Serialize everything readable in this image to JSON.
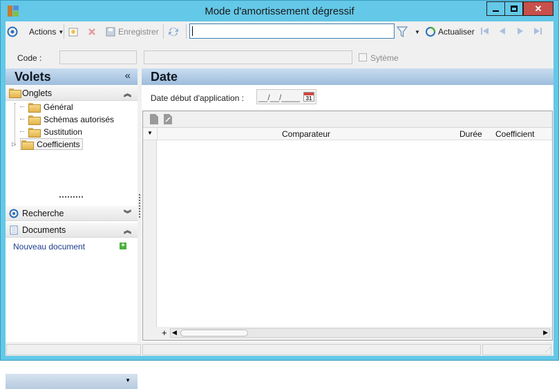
{
  "window": {
    "title": "Mode d'amortissement dégressif",
    "minimize": "—",
    "maximize": "□",
    "close": "✕"
  },
  "toolbar": {
    "actions_label": "Actions",
    "save_label": "Enregistrer",
    "search_value": "",
    "refresh_label": "Actualiser"
  },
  "record": {
    "code_label": "Code :",
    "code_value": "",
    "description_value": "",
    "system_label": "Sytème"
  },
  "left_panel": {
    "title": "Volets",
    "collapse_glyph": "«",
    "tabs_section": "Onglets",
    "tree": [
      "Général",
      "Schémas autorisés",
      "Sustitution",
      "Coefficients"
    ],
    "selected": "Coefficients",
    "search_section": "Recherche",
    "documents_section": "Documents",
    "new_document": "Nouveau document"
  },
  "main": {
    "title": "Date",
    "start_date_label": "Date début d'application :",
    "start_date_value": "__/__/____",
    "calendar_day": "31",
    "grid": {
      "columns": [
        "Comparateur",
        "Durée",
        "Coefficient"
      ],
      "rows": [],
      "add_glyph": "+"
    }
  },
  "colors": {
    "titlebar": "#64c8e8",
    "panel_header": "#b0cbe6",
    "accent_blue": "#2a6fb8"
  }
}
